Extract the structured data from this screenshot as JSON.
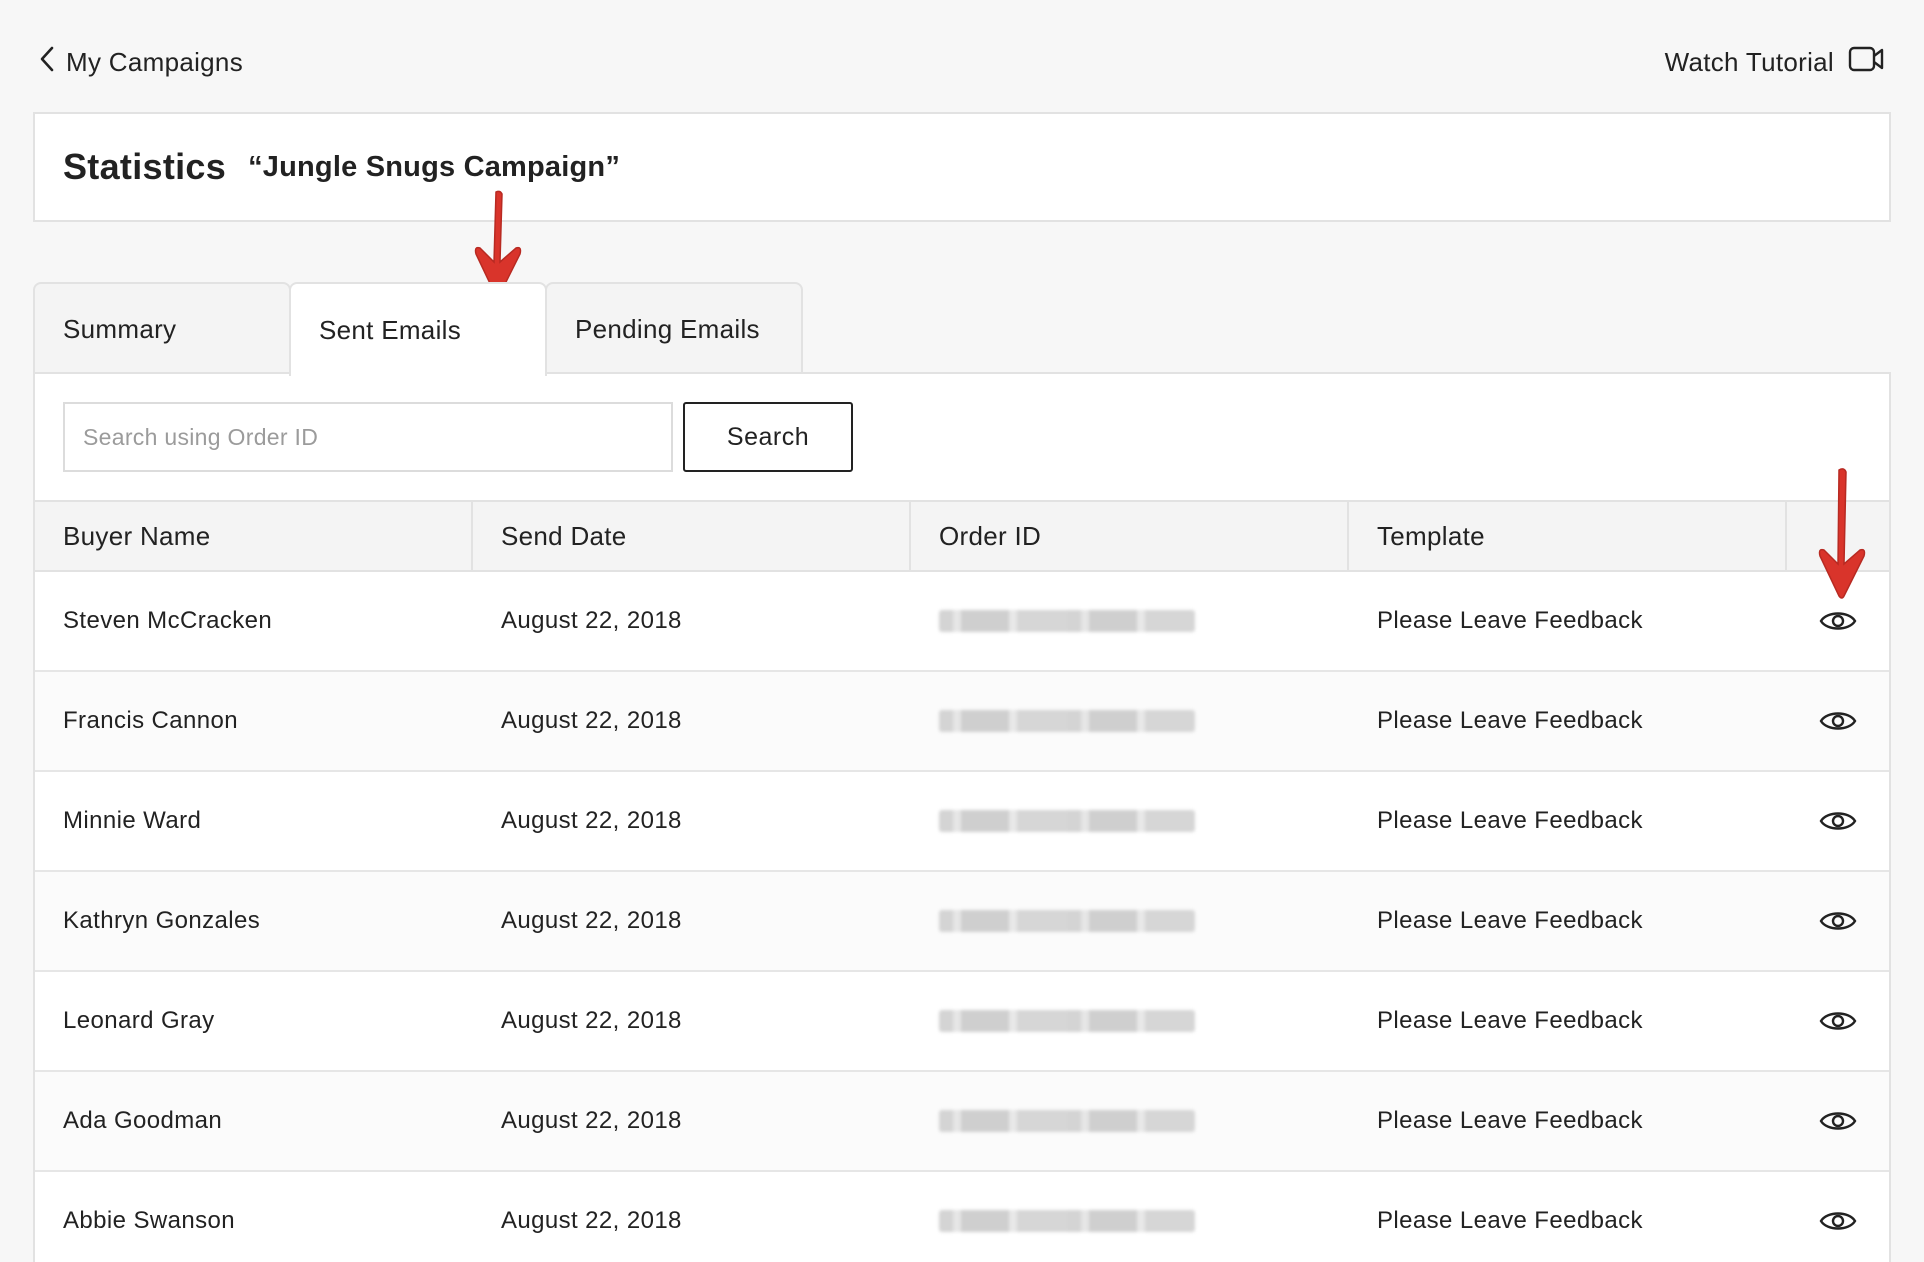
{
  "nav": {
    "back_label": "My Campaigns",
    "tutorial_label": "Watch Tutorial"
  },
  "header": {
    "title": "Statistics",
    "campaign_name": "“Jungle Snugs Campaign”"
  },
  "tabs": [
    {
      "label": "Summary",
      "active": false
    },
    {
      "label": "Sent Emails",
      "active": true
    },
    {
      "label": "Pending Emails",
      "active": false
    }
  ],
  "search": {
    "placeholder": "Search using Order ID",
    "value": "",
    "button_label": "Search"
  },
  "table": {
    "columns": [
      "Buyer Name",
      "Send Date",
      "Order ID",
      "Template"
    ],
    "rows": [
      {
        "buyer": "Steven McCracken",
        "date": "August 22, 2018",
        "template": "Please Leave Feedback"
      },
      {
        "buyer": "Francis Cannon",
        "date": "August 22, 2018",
        "template": "Please Leave Feedback"
      },
      {
        "buyer": "Minnie Ward",
        "date": "August 22, 2018",
        "template": "Please Leave Feedback"
      },
      {
        "buyer": "Kathryn Gonzales",
        "date": "August 22, 2018",
        "template": "Please Leave Feedback"
      },
      {
        "buyer": "Leonard Gray",
        "date": "August 22, 2018",
        "template": "Please Leave Feedback"
      },
      {
        "buyer": "Ada Goodman",
        "date": "August 22, 2018",
        "template": "Please Leave Feedback"
      },
      {
        "buyer": "Abbie Swanson",
        "date": "August 22, 2018",
        "template": "Please Leave Feedback"
      }
    ]
  },
  "colors": {
    "annotation_arrow": "#d9342b",
    "border": "#e2e2e2",
    "header_bg": "#f4f4f4"
  },
  "icons": {
    "back": "chevron-left-icon",
    "tutorial": "video-camera-icon",
    "view": "eye-icon"
  }
}
